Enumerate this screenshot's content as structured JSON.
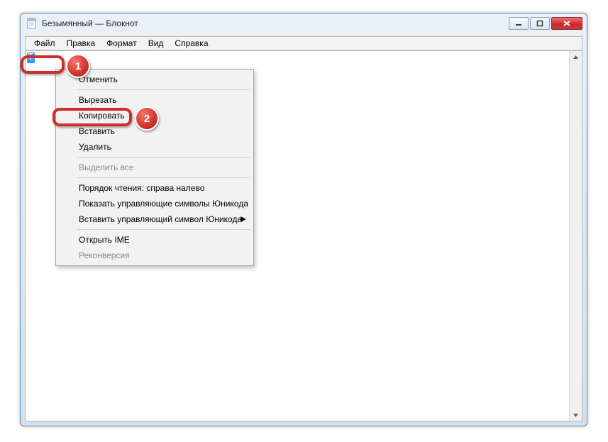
{
  "window": {
    "title": "Безымянный — Блокнот"
  },
  "menubar": {
    "items": [
      "Файл",
      "Правка",
      "Формат",
      "Вид",
      "Справка"
    ]
  },
  "editor": {
    "selected_text": "T"
  },
  "context_menu": {
    "undo": "Отменить",
    "cut": "Вырезать",
    "copy": "Копировать",
    "paste": "Вставить",
    "delete": "Удалить",
    "select_all": "Выделить все",
    "reading_order": "Порядок чтения: справа налево",
    "show_unicode": "Показать управляющие символы Юникода",
    "insert_unicode": "Вставить управляющий символ Юникода",
    "open_ime": "Открыть IME",
    "reconversion": "Реконверсия"
  },
  "callouts": {
    "one": "1",
    "two": "2"
  }
}
